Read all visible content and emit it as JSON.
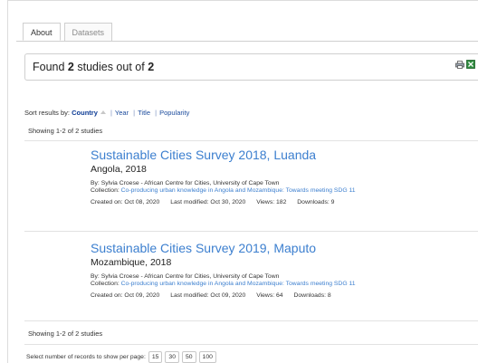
{
  "tabs": [
    {
      "label": "About",
      "active": true
    },
    {
      "label": "Datasets",
      "active": false
    }
  ],
  "summary": {
    "prefix": "Found ",
    "found": "2",
    "middle": " studies out of ",
    "total": "2"
  },
  "sort": {
    "label": "Sort results by:",
    "options": [
      "Country",
      "Year",
      "Title",
      "Popularity"
    ],
    "active": "Country"
  },
  "showing_top": "Showing 1-2 of 2 studies",
  "showing_bottom": "Showing 1-2 of 2 studies",
  "studies": [
    {
      "title": "Sustainable Cities Survey 2018, Luanda",
      "country_year": "Angola, 2018",
      "by": "By: Sylvia Croese - African Centre for Cities, University of Cape Town",
      "collection_label": "Collection: ",
      "collection": "Co-producing urban knowledge in Angola and Mozambique: Towards meeting SDG 11",
      "created": "Created on: Oct 08, 2020",
      "modified": "Last modified: Oct 30, 2020",
      "views": "Views: 182",
      "downloads": "Downloads: 9"
    },
    {
      "title": "Sustainable Cities Survey 2019, Maputo",
      "country_year": "Mozambique, 2018",
      "by": "By: Sylvia Croese - African Centre for Cities, University of Cape Town",
      "collection_label": "Collection: ",
      "collection": "Co-producing urban knowledge in Angola and Mozambique: Towards meeting SDG 11",
      "created": "Created on: Oct 09, 2020",
      "modified": "Last modified: Oct 09, 2020",
      "views": "Views: 64",
      "downloads": "Downloads: 8"
    }
  ],
  "pager": {
    "label": "Select number of records to show per page:",
    "options": [
      "15",
      "30",
      "50",
      "100"
    ]
  },
  "icons": {
    "print": "print-icon",
    "excel": "excel-icon"
  },
  "colors": {
    "link": "#3c7fcf",
    "sort_link": "#1a4a9c"
  }
}
